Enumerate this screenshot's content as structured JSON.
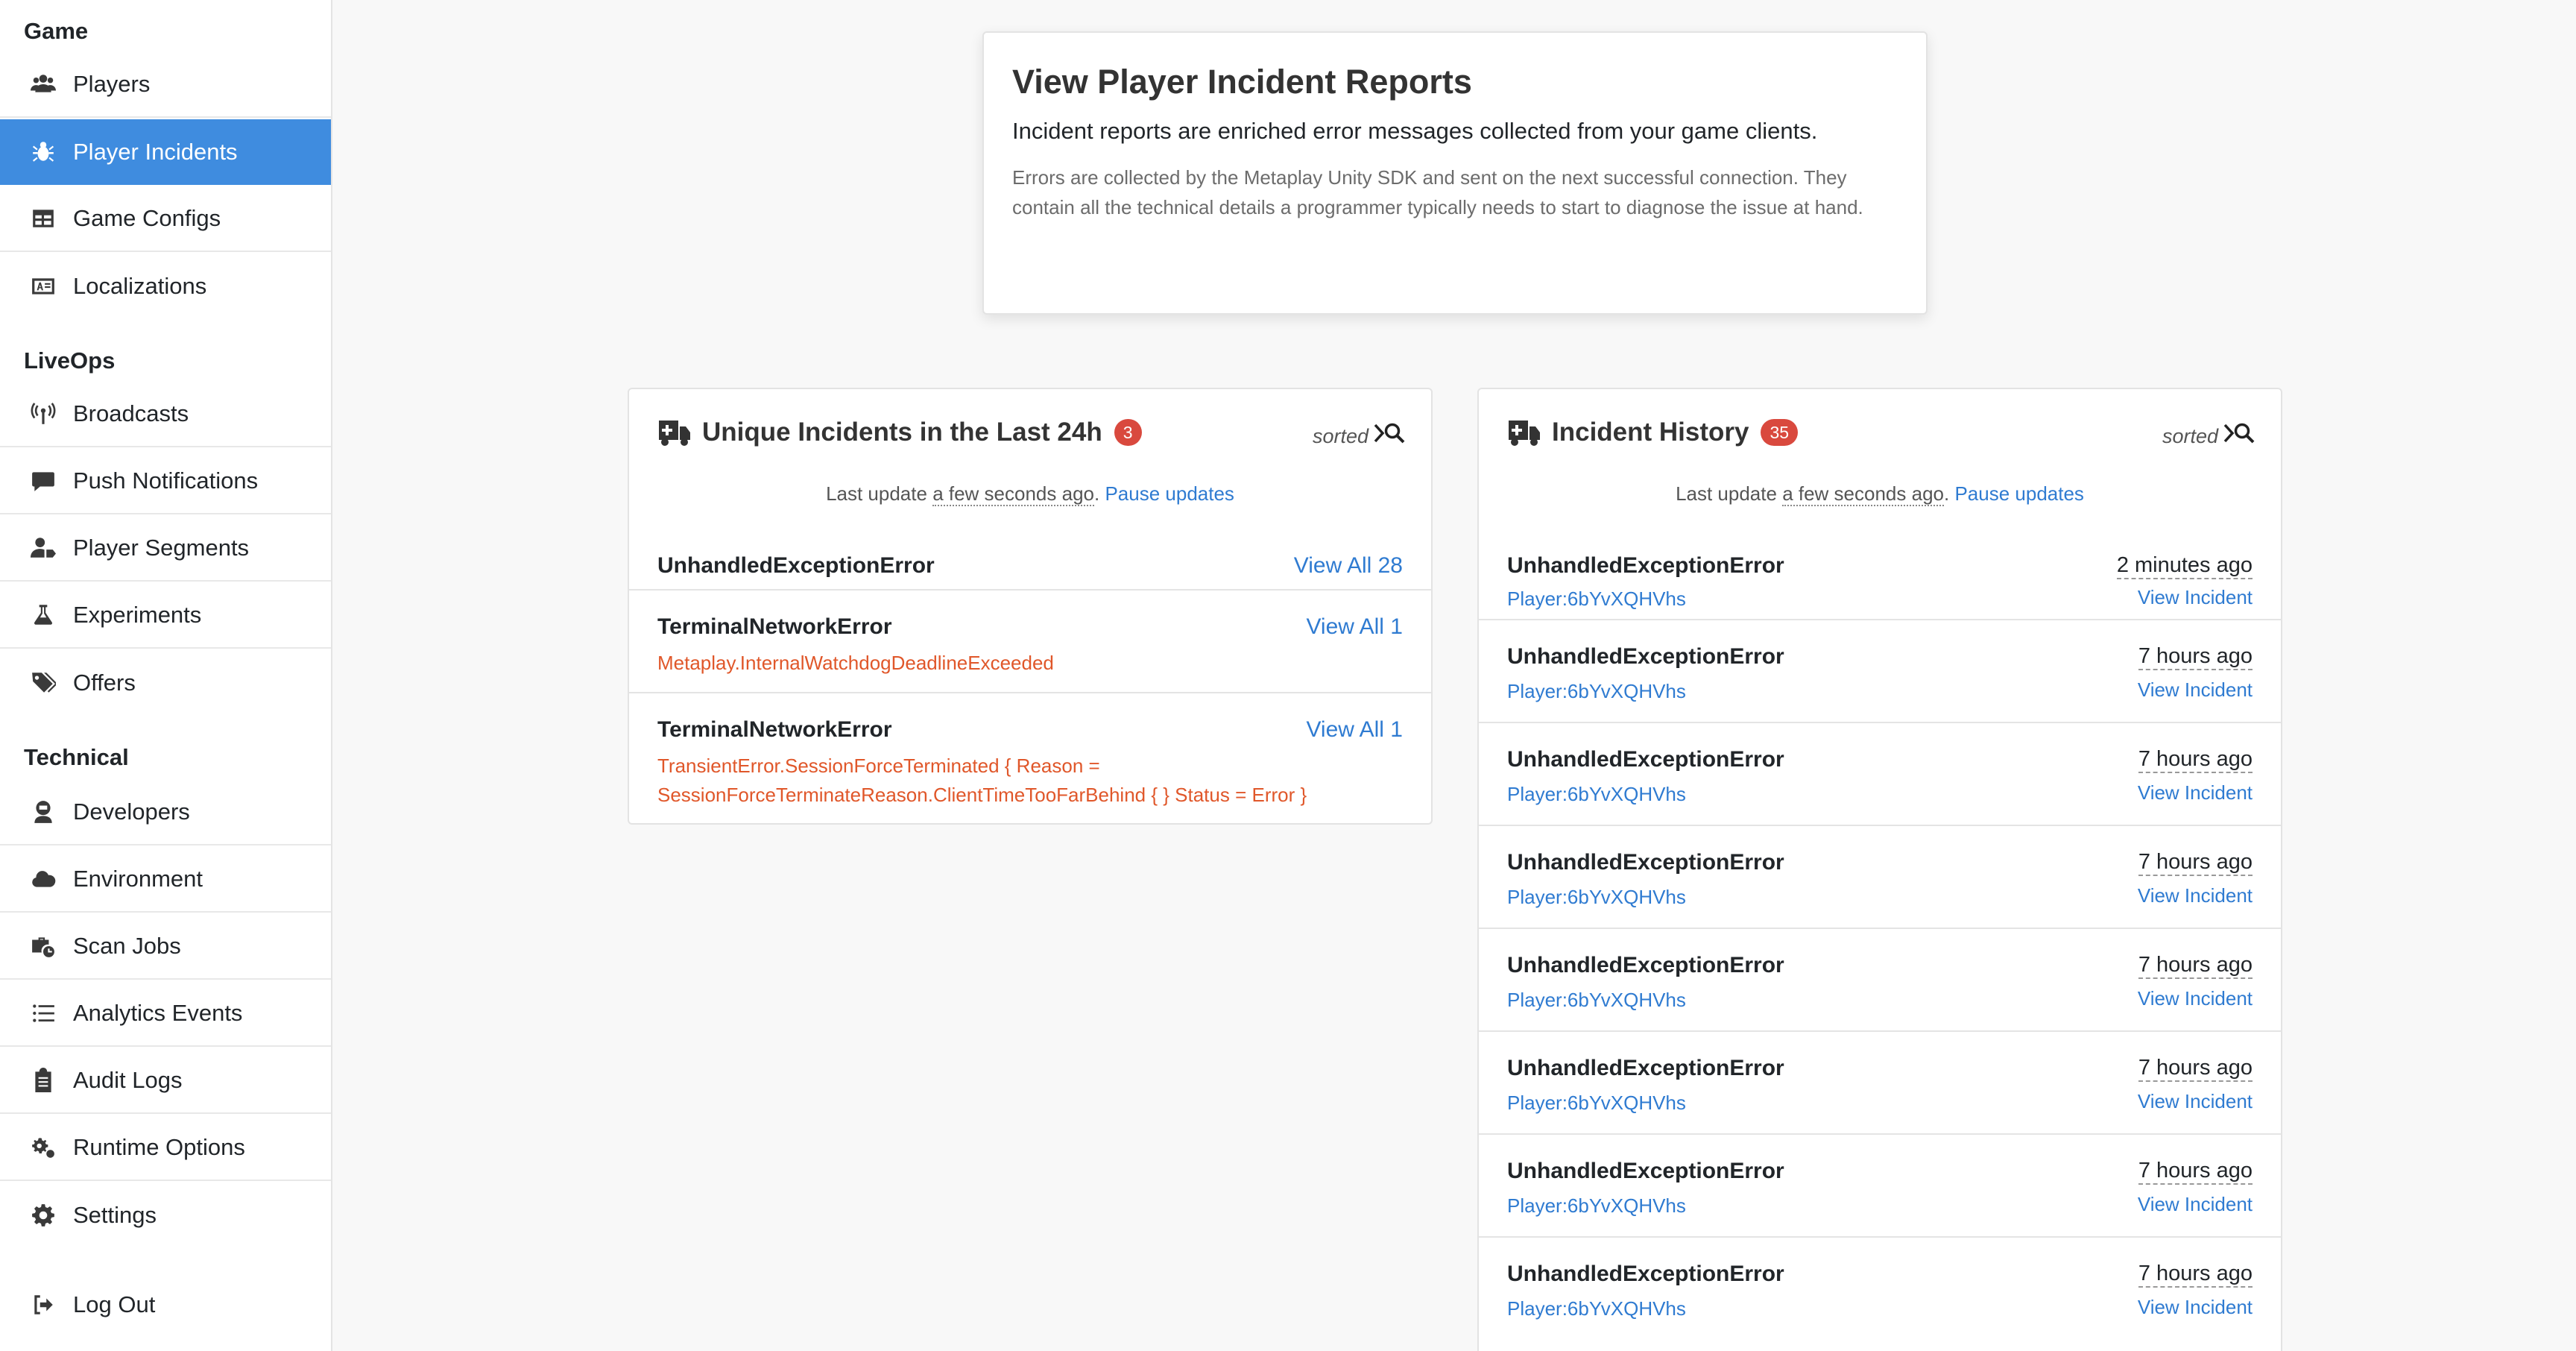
{
  "sidebar": {
    "sections": [
      {
        "title": "Game",
        "items": [
          {
            "label": "Players",
            "icon": "users-icon"
          },
          {
            "label": "Player Incidents",
            "icon": "bug-icon",
            "active": true
          },
          {
            "label": "Game Configs",
            "icon": "table-icon"
          },
          {
            "label": "Localizations",
            "icon": "language-icon"
          }
        ]
      },
      {
        "title": "LiveOps",
        "items": [
          {
            "label": "Broadcasts",
            "icon": "broadcast-tower-icon"
          },
          {
            "label": "Push Notifications",
            "icon": "comment-icon"
          },
          {
            "label": "Player Segments",
            "icon": "user-tag-icon"
          },
          {
            "label": "Experiments",
            "icon": "flask-icon"
          },
          {
            "label": "Offers",
            "icon": "tags-icon"
          }
        ]
      },
      {
        "title": "Technical",
        "items": [
          {
            "label": "Developers",
            "icon": "user-astronaut-icon"
          },
          {
            "label": "Environment",
            "icon": "cloud-icon"
          },
          {
            "label": "Scan Jobs",
            "icon": "business-time-icon"
          },
          {
            "label": "Analytics Events",
            "icon": "list-icon"
          },
          {
            "label": "Audit Logs",
            "icon": "clipboard-list-icon"
          },
          {
            "label": "Runtime Options",
            "icon": "cogs-icon"
          },
          {
            "label": "Settings",
            "icon": "gear-icon"
          }
        ]
      }
    ],
    "logout": {
      "label": "Log Out",
      "icon": "sign-out-icon"
    }
  },
  "header": {
    "title": "View Player Incident Reports",
    "lead": "Incident reports are enriched error messages collected from your game clients.",
    "small": "Errors are collected by the Metaplay Unity SDK and sent on the next successful connection. They contain all the technical details a programmer typically needs to start to diagnose the issue at hand."
  },
  "unique_card": {
    "title": "Unique Incidents in the Last 24h",
    "badge": "3",
    "sorted_label": "sorted",
    "update": {
      "prefix": "Last update ",
      "time": "a few seconds ago",
      "suffix": ". ",
      "pause": "Pause updates"
    },
    "rows": [
      {
        "title": "UnhandledExceptionError",
        "link": "View All 28",
        "detail": ""
      },
      {
        "title": "TerminalNetworkError",
        "link": "View All 1",
        "detail": "Metaplay.InternalWatchdogDeadlineExceeded"
      },
      {
        "title": "TerminalNetworkError",
        "link": "View All 1",
        "detail": "TransientError.SessionForceTerminated { Reason = SessionForceTerminateReason.ClientTimeTooFarBehind { } Status = Error }"
      }
    ]
  },
  "history_card": {
    "title": "Incident History",
    "badge": "35",
    "sorted_label": "sorted",
    "update": {
      "prefix": "Last update ",
      "time": "a few seconds ago",
      "suffix": ". ",
      "pause": "Pause updates"
    },
    "rows": [
      {
        "title": "UnhandledExceptionError",
        "player": "Player:6bYvXQHVhs",
        "time": "2 minutes ago",
        "link": "View Incident"
      },
      {
        "title": "UnhandledExceptionError",
        "player": "Player:6bYvXQHVhs",
        "time": "7 hours ago",
        "link": "View Incident"
      },
      {
        "title": "UnhandledExceptionError",
        "player": "Player:6bYvXQHVhs",
        "time": "7 hours ago",
        "link": "View Incident"
      },
      {
        "title": "UnhandledExceptionError",
        "player": "Player:6bYvXQHVhs",
        "time": "7 hours ago",
        "link": "View Incident"
      },
      {
        "title": "UnhandledExceptionError",
        "player": "Player:6bYvXQHVhs",
        "time": "7 hours ago",
        "link": "View Incident"
      },
      {
        "title": "UnhandledExceptionError",
        "player": "Player:6bYvXQHVhs",
        "time": "7 hours ago",
        "link": "View Incident"
      },
      {
        "title": "UnhandledExceptionError",
        "player": "Player:6bYvXQHVhs",
        "time": "7 hours ago",
        "link": "View Incident"
      },
      {
        "title": "UnhandledExceptionError",
        "player": "Player:6bYvXQHVhs",
        "time": "7 hours ago",
        "link": "View Incident"
      }
    ]
  },
  "colors": {
    "active_nav": "#3f8cdf",
    "link": "#2f7bd1",
    "error_text": "#e0572a",
    "badge": "#d9493e"
  }
}
